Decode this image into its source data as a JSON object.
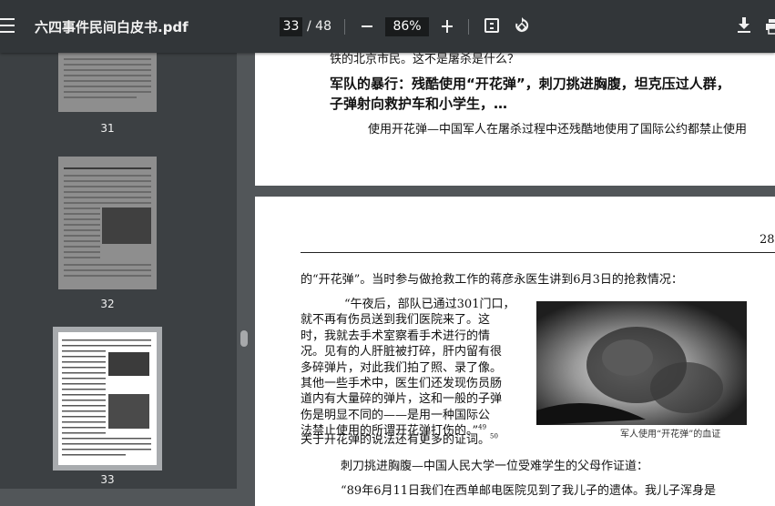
{
  "toolbar": {
    "title": "六四事件民间白皮书.pdf",
    "current_page": "33",
    "page_total": "/ 48",
    "zoom": "86%"
  },
  "thumbnails": [
    {
      "label": "31"
    },
    {
      "label": "32"
    },
    {
      "label": "33"
    }
  ],
  "page_top": {
    "line1": "铁的北京市民。这不是屠杀是什么？",
    "heading1": "军队的暴行：残酷使用“开花弹”，刺刀挑进胸腹，坦克压过人群，",
    "heading2": "子弹射向救护车和小学生，…",
    "para": "使用开花弹—中国军人在屠杀过程中还残酷地使用了国际公约都禁止使用"
  },
  "page_main": {
    "page_number": "28",
    "intro": "的“开花弹”。当时参与做抢救工作的蒋彦永医生讲到6月3日的抢救情况：",
    "quote_lines": [
      "“午夜后，部队已通过301门口，",
      "就不再有伤员送到我们医院来了。这",
      "时，我就去手术室察看手术进行的情",
      "况。见有的人肝脏被打碎，肝内留有很",
      "多碎弹片，对此我们拍了照、录了像。",
      "其他一些手术中，医生们还发现伤员肠",
      "道内有大量碎的弹片，这和一般的子弹",
      "伤是明显不同的——是用一种国际公",
      "法禁止使用的所谓开花弹打伤的。”"
    ],
    "footnote_49": "49",
    "last_line": "关于开花弹的说法还有更多的证词。",
    "footnote_50": "50",
    "caption": "军人使用“开花弹”的血证",
    "para2": "刺刀挑进胸腹—中国人民大学一位受难学生的父母作证道：",
    "para3": "“89年6月11日我们在西单邮电医院见到了我儿子的遗体。我儿子浑身是"
  }
}
